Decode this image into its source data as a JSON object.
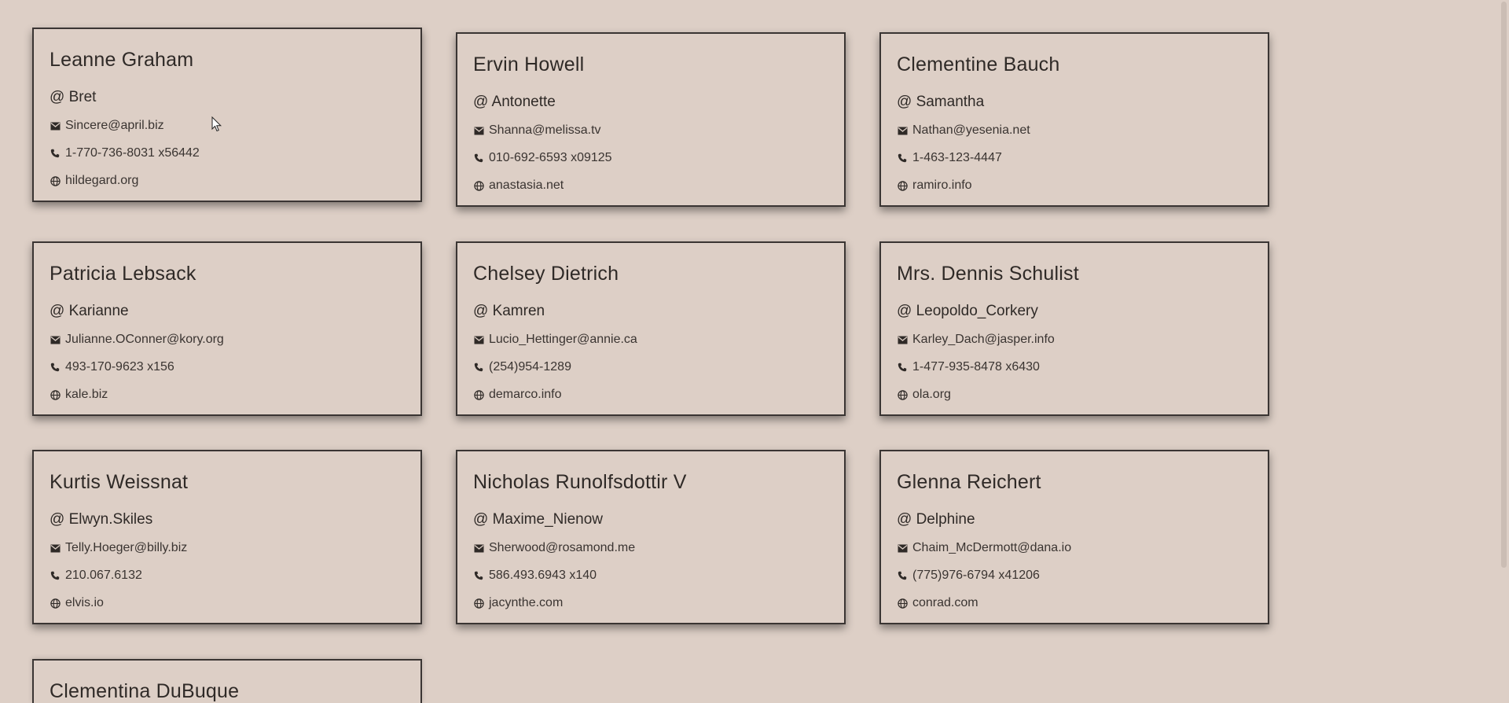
{
  "users": [
    {
      "name": "Leanne Graham",
      "username": "@ Bret",
      "email": "Sincere@april.biz",
      "phone": "1-770-736-8031 x56442",
      "website": "hildegard.org"
    },
    {
      "name": "Ervin Howell",
      "username": "@ Antonette",
      "email": "Shanna@melissa.tv",
      "phone": "010-692-6593 x09125",
      "website": "anastasia.net"
    },
    {
      "name": "Clementine Bauch",
      "username": "@ Samantha",
      "email": "Nathan@yesenia.net",
      "phone": "1-463-123-4447",
      "website": "ramiro.info"
    },
    {
      "name": "Patricia Lebsack",
      "username": "@ Karianne",
      "email": "Julianne.OConner@kory.org",
      "phone": "493-170-9623 x156",
      "website": "kale.biz"
    },
    {
      "name": "Chelsey Dietrich",
      "username": "@ Kamren",
      "email": "Lucio_Hettinger@annie.ca",
      "phone": "(254)954-1289",
      "website": "demarco.info"
    },
    {
      "name": "Mrs. Dennis Schulist",
      "username": "@ Leopoldo_Corkery",
      "email": "Karley_Dach@jasper.info",
      "phone": "1-477-935-8478 x6430",
      "website": "ola.org"
    },
    {
      "name": "Kurtis Weissnat",
      "username": "@ Elwyn.Skiles",
      "email": "Telly.Hoeger@billy.biz",
      "phone": "210.067.6132",
      "website": "elvis.io"
    },
    {
      "name": "Nicholas Runolfsdottir V",
      "username": "@ Maxime_Nienow",
      "email": "Sherwood@rosamond.me",
      "phone": "586.493.6943 x140",
      "website": "jacynthe.com"
    },
    {
      "name": "Glenna Reichert",
      "username": "@ Delphine",
      "email": "Chaim_McDermott@dana.io",
      "phone": "(775)976-6794 x41206",
      "website": "conrad.com"
    },
    {
      "name": "Clementina DuBuque",
      "username": "",
      "email": "",
      "phone": "",
      "website": ""
    }
  ],
  "icons": {
    "email": "envelope-icon",
    "phone": "phone-icon",
    "website": "globe-icon"
  },
  "colors": {
    "background": "#ddcfc6",
    "card_border": "#3a3533",
    "text": "#2f2a27"
  }
}
